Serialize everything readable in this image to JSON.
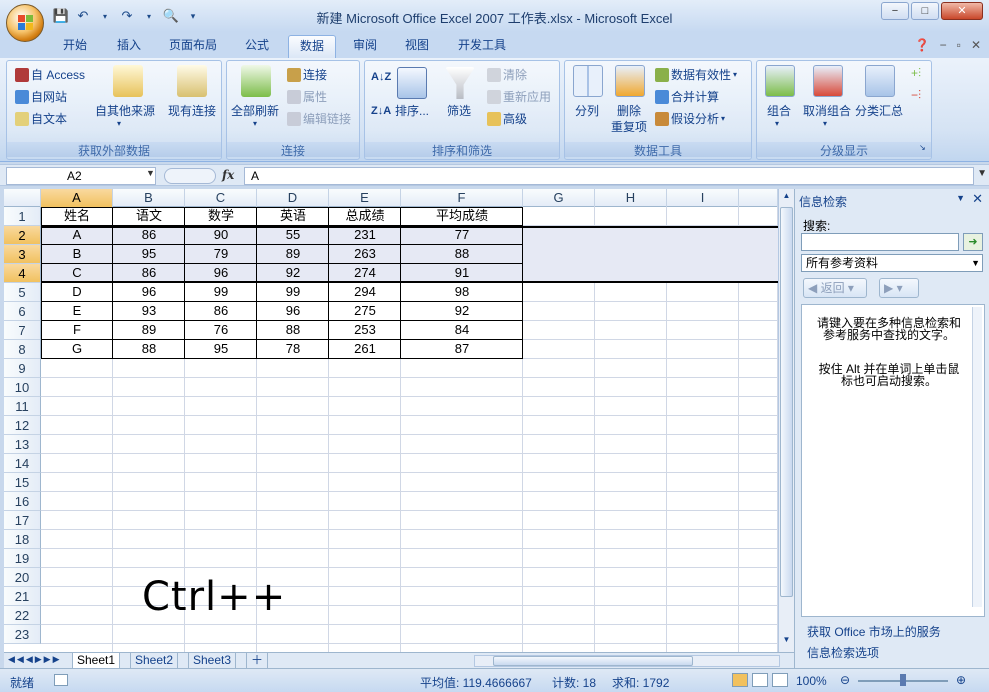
{
  "window": {
    "title": "新建 Microsoft Office Excel 2007 工作表.xlsx - Microsoft Excel",
    "min_label": "−",
    "max_label": "□",
    "close_label": "✕"
  },
  "tabs": [
    {
      "label": "开始"
    },
    {
      "label": "插入"
    },
    {
      "label": "页面布局"
    },
    {
      "label": "公式"
    },
    {
      "label": "数据",
      "active": true
    },
    {
      "label": "审阅"
    },
    {
      "label": "视图"
    },
    {
      "label": "开发工具"
    }
  ],
  "ribbon": {
    "groups": {
      "external": {
        "label": "获取外部数据",
        "access": "自 Access",
        "web": "自网站",
        "text": "自文本",
        "other": "自其他来源",
        "existing": "现有连接"
      },
      "connections": {
        "label": "连接",
        "refresh_all": "全部刷新",
        "connections": "连接",
        "properties": "属性",
        "edit_links": "编辑链接"
      },
      "sort_filter": {
        "label": "排序和筛选",
        "sort": "排序...",
        "filter": "筛选",
        "clear": "清除",
        "reapply": "重新应用",
        "advanced": "高级"
      },
      "data_tools": {
        "label": "数据工具",
        "text_to_columns": "分列",
        "remove_duplicates_1": "删除",
        "remove_duplicates_2": "重复项",
        "validation": "数据有效性",
        "consolidate": "合并计算",
        "what_if": "假设分析"
      },
      "outline": {
        "label": "分级显示",
        "group": "组合",
        "ungroup": "取消组合",
        "subtotal": "分类汇总"
      }
    }
  },
  "formula_bar": {
    "name_box": "A2",
    "fx": "fx",
    "formula": "A"
  },
  "sheet": {
    "columns": [
      "A",
      "B",
      "C",
      "D",
      "E",
      "F",
      "G",
      "H",
      "I"
    ],
    "rows": [
      "1",
      "2",
      "3",
      "4",
      "5",
      "6",
      "7",
      "8",
      "9",
      "10",
      "11",
      "12",
      "13",
      "14",
      "15",
      "16",
      "17",
      "18",
      "19",
      "20",
      "21",
      "22",
      "23"
    ],
    "header": [
      "姓名",
      "语文",
      "数学",
      "英语",
      "总成绩",
      "平均成绩"
    ],
    "data": [
      [
        "A",
        "86",
        "90",
        "55",
        "231",
        "77"
      ],
      [
        "B",
        "95",
        "79",
        "89",
        "263",
        "88"
      ],
      [
        "C",
        "86",
        "96",
        "92",
        "274",
        "91"
      ],
      [
        "D",
        "96",
        "99",
        "99",
        "294",
        "98"
      ],
      [
        "E",
        "93",
        "86",
        "96",
        "275",
        "92"
      ],
      [
        "F",
        "89",
        "76",
        "88",
        "253",
        "84"
      ],
      [
        "G",
        "88",
        "95",
        "78",
        "261",
        "87"
      ]
    ],
    "annotation": "Ctrl++"
  },
  "sheet_tabs": [
    {
      "label": "Sheet1",
      "active": true
    },
    {
      "label": "Sheet2"
    },
    {
      "label": "Sheet3"
    }
  ],
  "status": {
    "ready": "就绪",
    "average": "平均值: 119.4666667",
    "count": "计数: 18",
    "sum": "求和: 1792",
    "zoom": "100%"
  },
  "research_panel": {
    "title": "信息检索",
    "search_label": "搜索:",
    "search_value": "",
    "source": "所有参考资料",
    "back": "返回",
    "message1": "请键入要在多种信息检索和参考服务中查找的文字。",
    "message2": "按住 Alt 并在单词上单击鼠标也可启动搜索。",
    "link1": "获取 Office 市场上的服务",
    "link2": "信息检索选项"
  },
  "colors": {
    "ribbon_bg": "#d5e3f4",
    "selection_header": "#f1c15f",
    "selected_cell_bg": "#e6e9f4"
  }
}
